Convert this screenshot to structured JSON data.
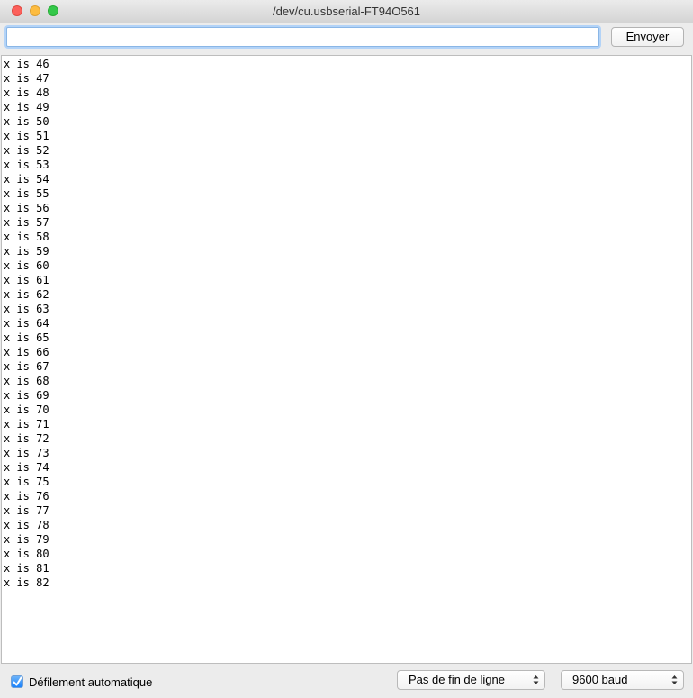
{
  "window": {
    "title": "/dev/cu.usbserial-FT94O561"
  },
  "input": {
    "value": "",
    "placeholder": ""
  },
  "toolbar": {
    "send_label": "Envoyer"
  },
  "console": {
    "lines": [
      "x is 46",
      "x is 47",
      "x is 48",
      "x is 49",
      "x is 50",
      "x is 51",
      "x is 52",
      "x is 53",
      "x is 54",
      "x is 55",
      "x is 56",
      "x is 57",
      "x is 58",
      "x is 59",
      "x is 60",
      "x is 61",
      "x is 62",
      "x is 63",
      "x is 64",
      "x is 65",
      "x is 66",
      "x is 67",
      "x is 68",
      "x is 69",
      "x is 70",
      "x is 71",
      "x is 72",
      "x is 73",
      "x is 74",
      "x is 75",
      "x is 76",
      "x is 77",
      "x is 78",
      "x is 79",
      "x is 80",
      "x is 81",
      "x is 82"
    ]
  },
  "footer": {
    "autoscroll_label": "Défilement automatique",
    "autoscroll_checked": true,
    "line_ending_selected": "Pas de fin de ligne",
    "baud_selected": "9600 baud"
  },
  "colors": {
    "close": "#fc605b",
    "minimize": "#fdbc40",
    "maximize": "#34c84a",
    "focus_ring": "#b3d3f7",
    "checkbox_accent": "#1a82fb"
  },
  "icons": {
    "close": "close-icon",
    "minimize": "minimize-icon",
    "maximize": "maximize-icon",
    "checkbox": "checkmark-icon",
    "select_arrows": "updown-arrows-icon"
  }
}
